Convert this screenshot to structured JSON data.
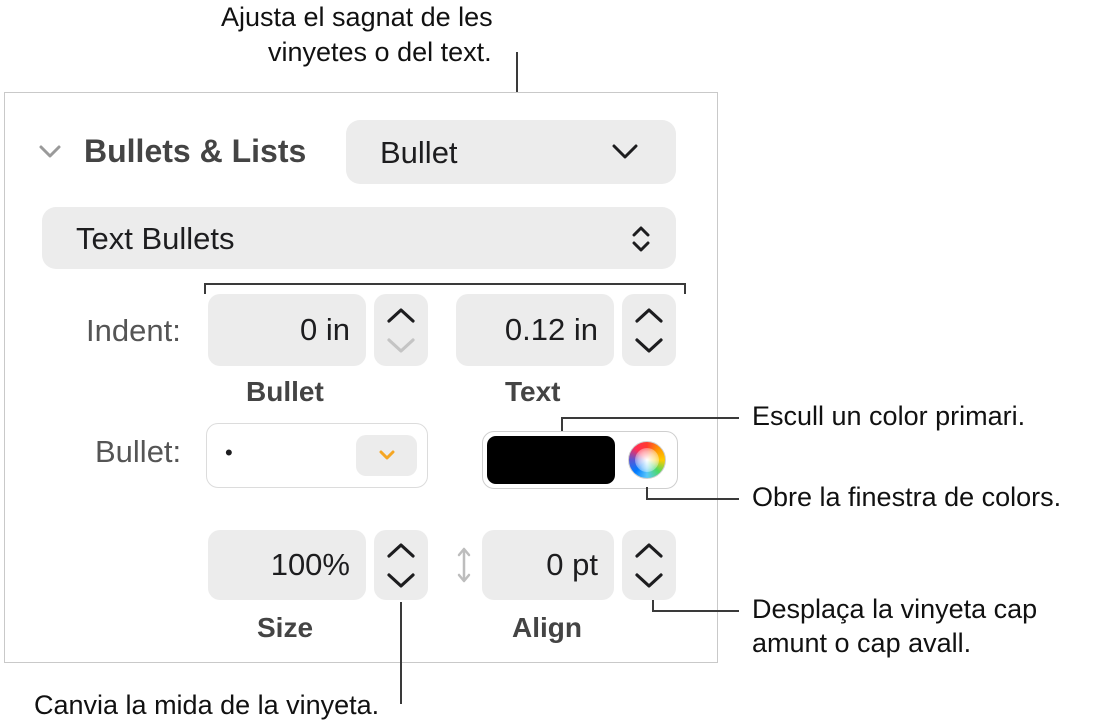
{
  "callouts": {
    "indent_line1": "Ajusta el sagnat de les",
    "indent_line2": "vinyetes o del text.",
    "primary_color": "Escull un color primari.",
    "color_window": "Obre la finestra de colors.",
    "align_line1": "Desplaça la vinyeta cap",
    "align_line2": "amunt o cap avall.",
    "size": "Canvia la mida de la vinyeta."
  },
  "panel": {
    "section_title": "Bullets & Lists",
    "list_style_value": "Bullet",
    "bullet_type_value": "Text Bullets",
    "indent_label": "Indent:",
    "bullet_indent_value": "0 in",
    "text_indent_value": "0.12 in",
    "bullet_caption": "Bullet",
    "text_caption": "Text",
    "bullet_label": "Bullet:",
    "bullet_char": "•",
    "bullet_color": "#000000",
    "size_value": "100%",
    "align_value": "0 pt",
    "size_caption": "Size",
    "align_caption": "Align"
  },
  "icons": {
    "disclosure": "chevron-down-icon",
    "popup": "chevron-down-icon",
    "updown": "up-down-chevrons-icon",
    "color_wheel": "color-wheel-icon",
    "align_arrow": "vertical-arrow-icon"
  },
  "colors": {
    "accent_orange": "#f5a623",
    "field_bg": "#ececec"
  }
}
